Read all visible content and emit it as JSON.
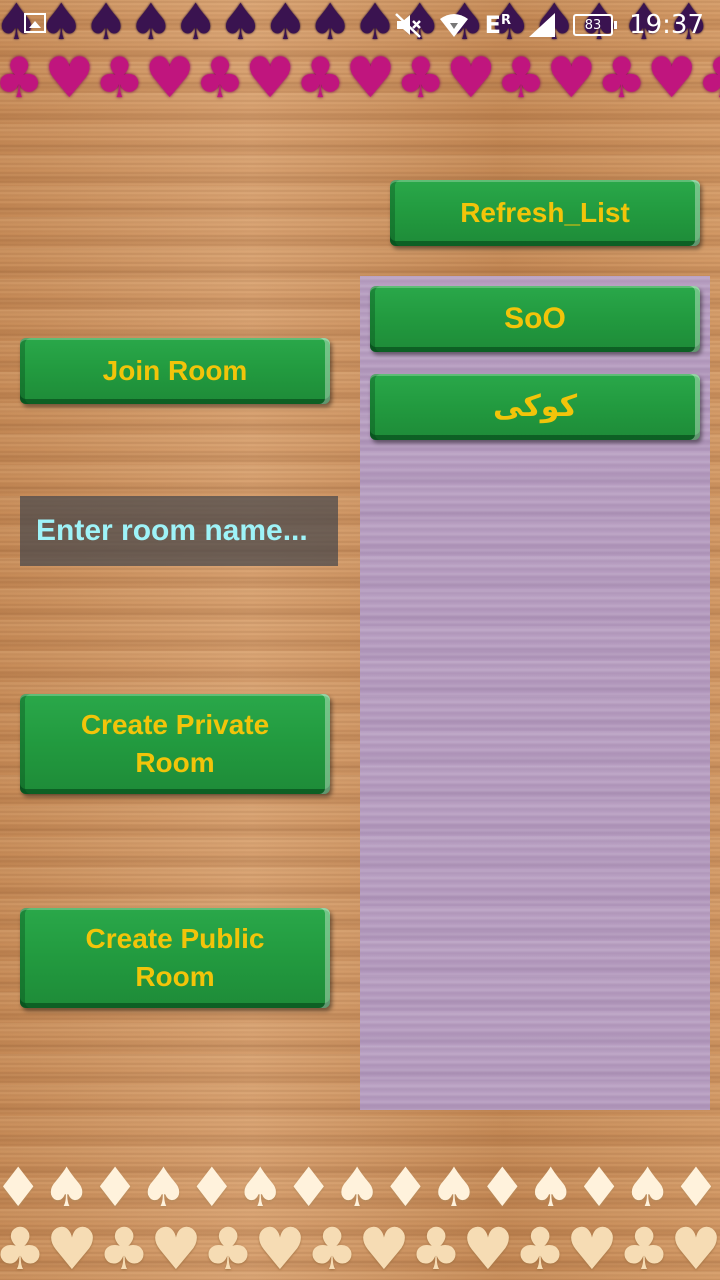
{
  "status_bar": {
    "left_icon": "image-notification-icon",
    "icons": [
      "mute-icon",
      "wifi-icon",
      "signal-icon"
    ],
    "network_label": "E",
    "network_sup": "R",
    "battery_level": "83",
    "time": "19:37"
  },
  "decor": {
    "top_row_1": "♠♠♠♠♠♠♠♠♠♠♠♠♠♠♠♠",
    "top_row_2": "♣♥♣♥♣♥♣♥♣♥♣♥♣♥♣♥",
    "bottom_row_1": "♦♠♦♠♦♠♦♠♦♠♦♠♦♠♦♠",
    "bottom_row_2": "♣♥♣♥♣♥♣♥♣♥♣♥♣♥♣♥"
  },
  "actions": {
    "refresh_label": "Refresh_List",
    "join_label": "Join Room",
    "create_private_label": "Create Private\nRoom",
    "create_public_label": "Create Public\nRoom"
  },
  "room_input": {
    "value": "",
    "placeholder": "Enter room name..."
  },
  "rooms": [
    {
      "name": "SoO"
    },
    {
      "name": "کوکی"
    }
  ],
  "colors": {
    "button_green": "#229a3f",
    "button_text": "#f2c40a",
    "input_text": "#9ef3f8",
    "list_panel": "#b59bbf"
  }
}
